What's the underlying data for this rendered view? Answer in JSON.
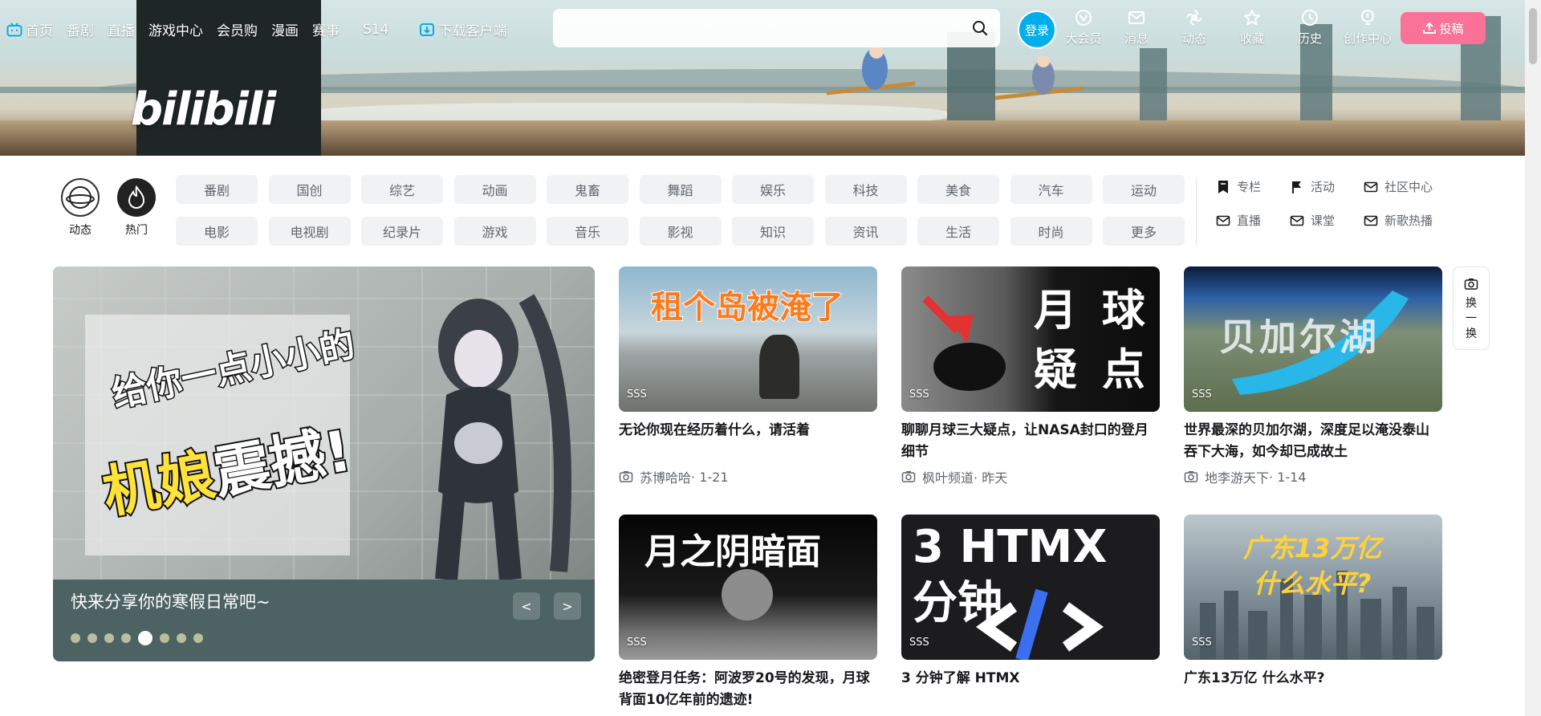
{
  "header": {
    "nav_left": [
      "首页",
      "番剧",
      "直播",
      "游戏中心",
      "会员购",
      "漫画",
      "赛事",
      "S14"
    ],
    "download": "下载客户端",
    "search_placeholder": "",
    "login": "登录",
    "nav_right": [
      "大会员",
      "消息",
      "动态",
      "收藏",
      "历史",
      "创作中心"
    ],
    "upload": "投稿",
    "logo_text": "bilibili"
  },
  "channels": {
    "circle_items": [
      "动态",
      "热门"
    ],
    "chips": [
      "番剧",
      "国创",
      "综艺",
      "动画",
      "鬼畜",
      "舞蹈",
      "娱乐",
      "科技",
      "美食",
      "汽车",
      "运动",
      "电影",
      "电视剧",
      "纪录片",
      "游戏",
      "音乐",
      "影视",
      "知识",
      "资讯",
      "生活",
      "时尚",
      "更多"
    ],
    "links": [
      "专栏",
      "活动",
      "社区中心",
      "直播",
      "课堂",
      "新歌热播"
    ]
  },
  "carousel": {
    "caption": "快来分享你的寒假日常吧~",
    "image_text_line1": "给你一点小小的",
    "image_text_line2a": "机娘",
    "image_text_line2b": "震撼!",
    "prev": "<",
    "next": ">",
    "dot_count": 8,
    "active_dot": 4
  },
  "refresh": [
    "换",
    "一",
    "换"
  ],
  "cards": [
    {
      "thumb_text": "租个岛被淹了",
      "tag": "SSS",
      "title": "无论你现在经历着什么，请活着",
      "author": "苏博哈哈",
      "date": "· 1-21"
    },
    {
      "thumb_text": "月 球 疑 点",
      "tag": "SSS",
      "title": "聊聊月球三大疑点，让NASA封口的登月细节",
      "author": "枫叶频道",
      "date": "· 昨天"
    },
    {
      "thumb_text": "贝加尔湖",
      "tag": "SSS",
      "title": "世界最深的贝加尔湖，深度足以淹没泰山吞下大海，如今却已成故土",
      "author": "地李游天下",
      "date": "· 1-14"
    },
    {
      "thumb_text": "月之阴暗面",
      "tag": "SSS",
      "title": "绝密登月任务：阿波罗20号的发现，月球背面10亿年前的遗迹!",
      "author": "",
      "date": ""
    },
    {
      "thumb_text": "3 HTMX 分钟",
      "tag": "SSS",
      "title": "3 分钟了解 HTMX",
      "author": "",
      "date": ""
    },
    {
      "thumb_text": "广东13万亿 什么水平?",
      "tag": "SSS",
      "title": "广东13万亿 什么水平?",
      "author": "",
      "date": ""
    }
  ],
  "colors": {
    "accent_blue": "#00aeec",
    "upload_pink": "#fb7299",
    "chip_bg": "#f1f2f3"
  }
}
